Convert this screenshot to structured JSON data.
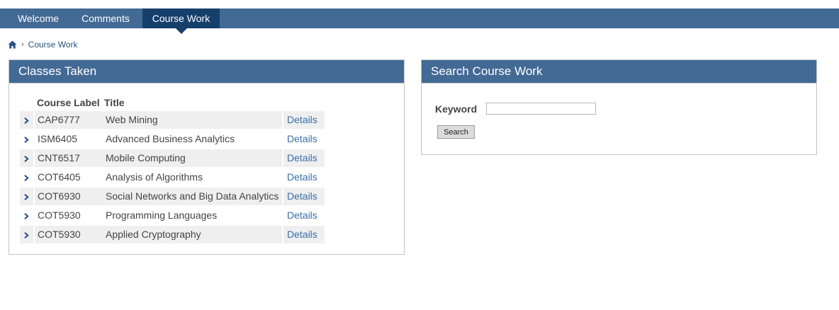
{
  "nav": {
    "tabs": [
      {
        "label": "Welcome"
      },
      {
        "label": "Comments"
      },
      {
        "label": "Course Work"
      }
    ]
  },
  "breadcrumb": {
    "icon": "home-icon",
    "current": "Course Work"
  },
  "classes": {
    "title": "Classes Taken",
    "headers": {
      "label": "Course Label",
      "title": "Title"
    },
    "rows": [
      {
        "label": "CAP6777",
        "title": "Web Mining",
        "details": "Details"
      },
      {
        "label": "ISM6405",
        "title": "Advanced Business Analytics",
        "details": "Details"
      },
      {
        "label": "CNT6517",
        "title": "Mobile Computing",
        "details": "Details"
      },
      {
        "label": "COT6405",
        "title": "Analysis of Algorithms",
        "details": "Details"
      },
      {
        "label": "COT6930",
        "title": "Social Networks and Big Data Analytics",
        "details": "Details"
      },
      {
        "label": "COT5930",
        "title": "Programming Languages",
        "details": "Details"
      },
      {
        "label": "COT5930",
        "title": "Applied Cryptography",
        "details": "Details"
      }
    ]
  },
  "search": {
    "title": "Search Course Work",
    "keyword_label": "Keyword",
    "keyword_value": "",
    "button_label": "Search"
  },
  "colors": {
    "nav_bg": "#436a95",
    "nav_active": "#173f6b",
    "link": "#3a6ea5"
  }
}
